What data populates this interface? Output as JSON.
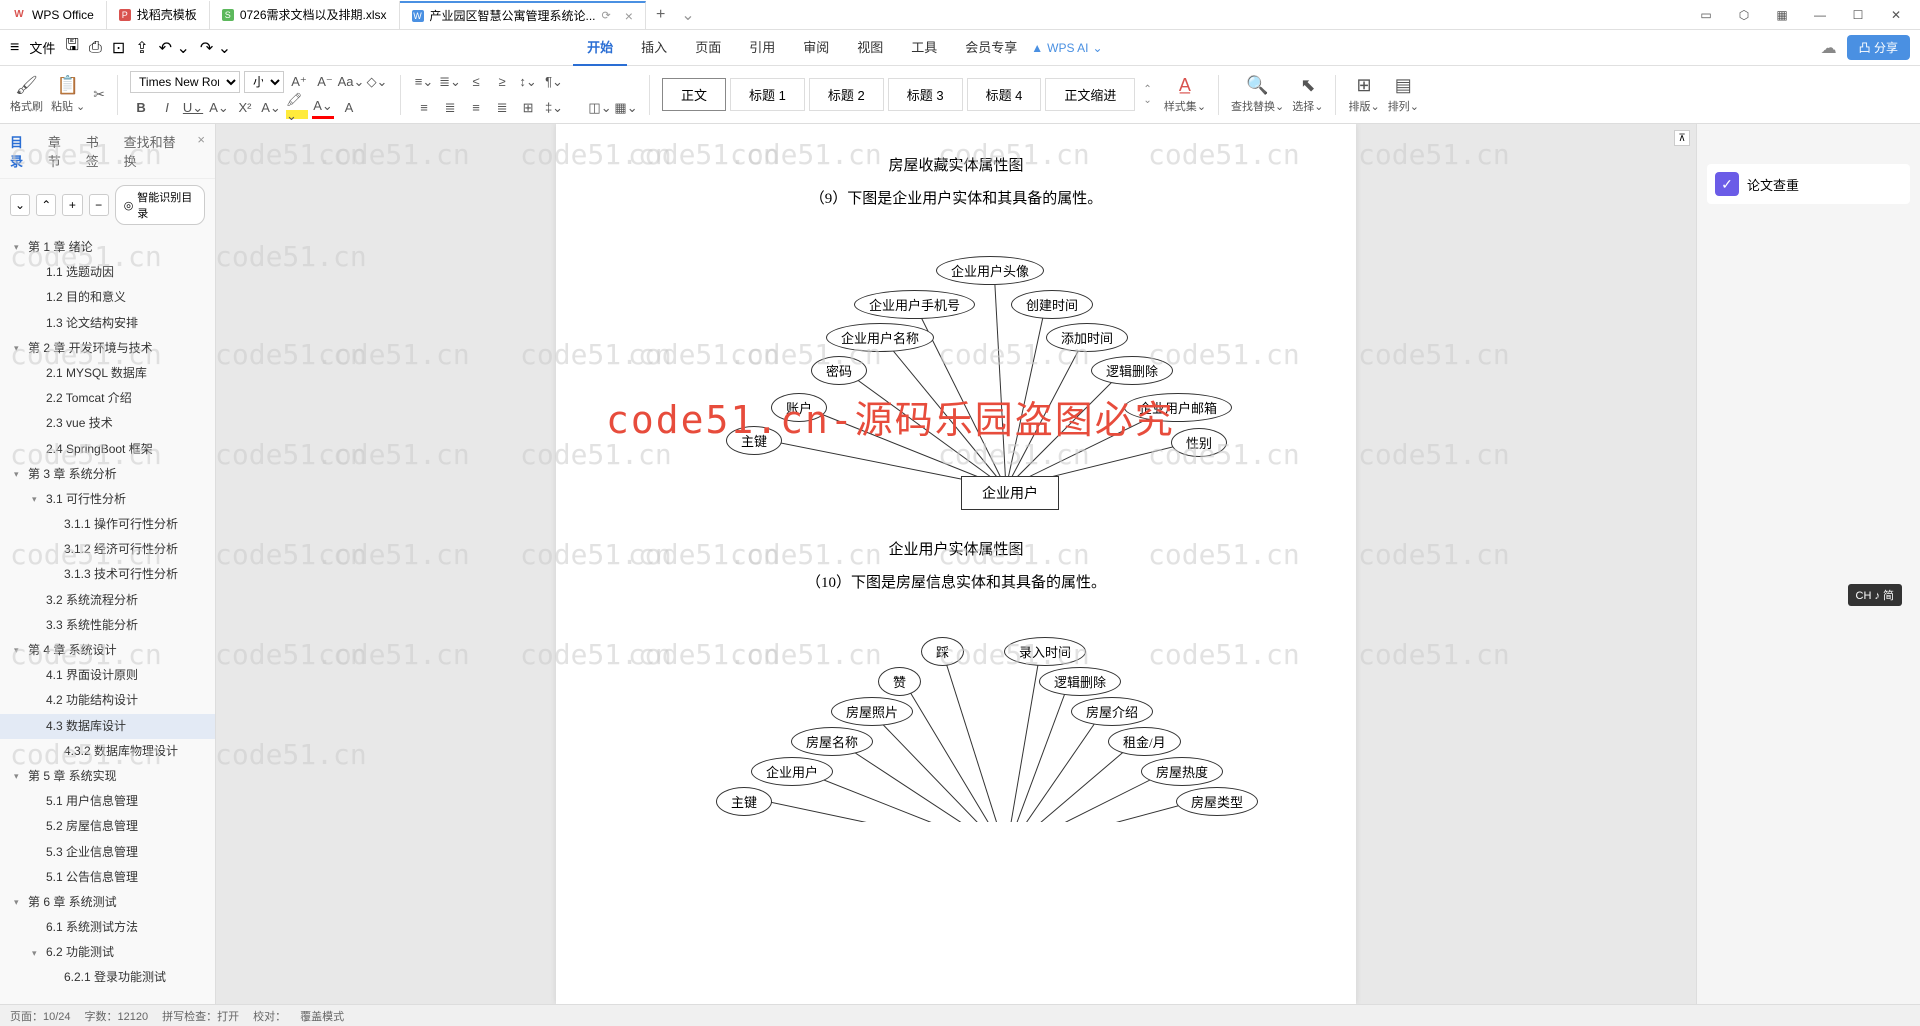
{
  "titlebar": {
    "tabs": [
      {
        "icon": "w",
        "label": "WPS Office"
      },
      {
        "icon": "p",
        "label": "找稻壳模板"
      },
      {
        "icon": "s",
        "label": "0726需求文档以及排期.xlsx"
      },
      {
        "icon": "doc",
        "label": "产业园区智慧公寓管理系统论..."
      }
    ],
    "add": "+"
  },
  "menubar": {
    "file": "文件",
    "tabs": [
      "开始",
      "插入",
      "页面",
      "引用",
      "审阅",
      "视图",
      "工具",
      "会员专享"
    ],
    "active_tab": "开始",
    "wps_ai": "WPS AI",
    "share": "分享"
  },
  "ribbon": {
    "format_painter": "格式刷",
    "paste": "粘贴",
    "font_name": "Times New Roma",
    "font_size": "小四",
    "styles": [
      "正文",
      "标题 1",
      "标题 2",
      "标题 3",
      "标题 4",
      "正文缩进"
    ],
    "style_set": "样式集",
    "find_replace": "查找替换",
    "select": "选择",
    "sort": "排版",
    "arrange": "排列"
  },
  "nav": {
    "tabs": [
      "目录",
      "章节",
      "书签",
      "查找和替换"
    ],
    "active": "目录",
    "smart_toc": "智能识别目录",
    "items": [
      {
        "level": 1,
        "label": "第 1 章 绪论",
        "caret": true
      },
      {
        "level": 2,
        "label": "1.1 选题动因"
      },
      {
        "level": 2,
        "label": "1.2 目的和意义"
      },
      {
        "level": 2,
        "label": "1.3 论文结构安排"
      },
      {
        "level": 1,
        "label": "第 2 章 开发环境与技术",
        "caret": true
      },
      {
        "level": 2,
        "label": "2.1 MYSQL 数据库"
      },
      {
        "level": 2,
        "label": "2.2 Tomcat  介绍"
      },
      {
        "level": 2,
        "label": "2.3 vue 技术"
      },
      {
        "level": 2,
        "label": "2.4 SpringBoot 框架"
      },
      {
        "level": 1,
        "label": "第 3 章 系统分析",
        "caret": true
      },
      {
        "level": 2,
        "label": "3.1 可行性分析",
        "caret": true
      },
      {
        "level": 3,
        "label": "3.1.1 操作可行性分析"
      },
      {
        "level": 3,
        "label": "3.1.2 经济可行性分析"
      },
      {
        "level": 3,
        "label": "3.1.3 技术可行性分析"
      },
      {
        "level": 2,
        "label": "3.2 系统流程分析"
      },
      {
        "level": 2,
        "label": "3.3 系统性能分析"
      },
      {
        "level": 1,
        "label": "第 4 章 系统设计",
        "caret": true
      },
      {
        "level": 2,
        "label": "4.1 界面设计原则"
      },
      {
        "level": 2,
        "label": "4.2 功能结构设计"
      },
      {
        "level": 2,
        "label": "4.3 数据库设计",
        "active": true
      },
      {
        "level": 3,
        "label": "4.3.2 数据库物理设计"
      },
      {
        "level": 1,
        "label": "第 5 章 系统实现",
        "caret": true
      },
      {
        "level": 2,
        "label": "5.1 用户信息管理"
      },
      {
        "level": 2,
        "label": "5.2 房屋信息管理"
      },
      {
        "level": 2,
        "label": "5.3 企业信息管理"
      },
      {
        "level": 2,
        "label": "5.1 公告信息管理"
      },
      {
        "level": 1,
        "label": "第 6 章 系统测试",
        "caret": true
      },
      {
        "level": 2,
        "label": "6.1 系统测试方法"
      },
      {
        "level": 2,
        "label": "6.2 功能测试",
        "caret": true
      },
      {
        "level": 3,
        "label": "6.2.1 登录功能测试"
      }
    ]
  },
  "document": {
    "caption1": "房屋收藏实体属性图",
    "p1": "（9）下图是企业用户实体和其具备的属性。",
    "er1_entity": "企业用户",
    "er1_attrs": [
      "主键",
      "账户",
      "密码",
      "企业用户名称",
      "企业用户手机号",
      "企业用户头像",
      "创建时间",
      "添加时间",
      "逻辑删除",
      "企业用户邮箱",
      "性别"
    ],
    "caption2": "企业用户实体属性图",
    "p2": "（10）下图是房屋信息实体和其具备的属性。",
    "er2_attrs": [
      "主键",
      "企业用户",
      "房屋名称",
      "房屋照片",
      "赞",
      "踩",
      "录入时间",
      "逻辑删除",
      "房屋介绍",
      "租金/月",
      "房屋热度",
      "房屋类型"
    ]
  },
  "right": {
    "paper_check": "论文查重"
  },
  "status": {
    "page": "页面：10/24",
    "words": "字数：12120",
    "spell": "拼写检查：打开",
    "proof": "校对：",
    "mode": "覆盖模式"
  },
  "watermark": "code51.cn",
  "red_watermark": "code51.cn-源码乐园盗图必究",
  "ime": "CH ♪ 简"
}
